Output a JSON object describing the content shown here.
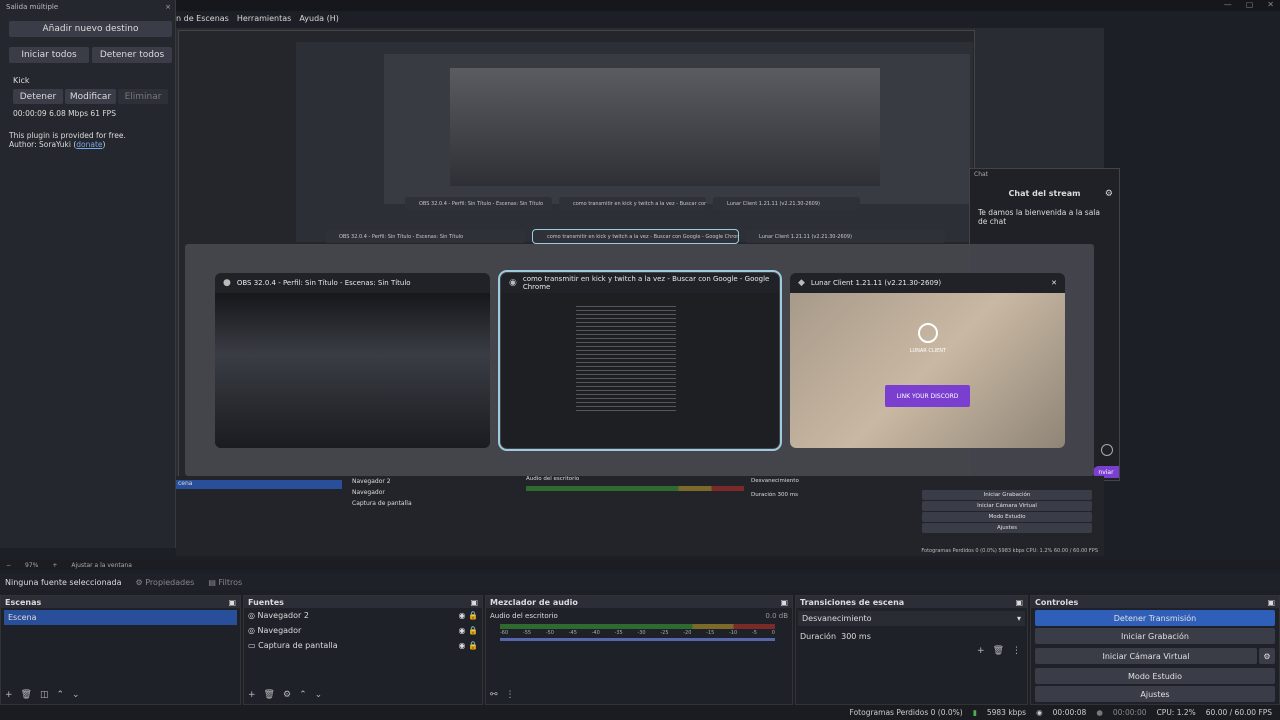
{
  "menu": [
    "n de Escenas",
    "Herramientas",
    "Ayuda (H)"
  ],
  "window_controls": [
    "—",
    "▢",
    "✕"
  ],
  "multi_output": {
    "title": "Salida múltiple",
    "add_destination": "Añadir nuevo destino",
    "start_all": "Iniciar todos",
    "stop_all": "Detener todos",
    "service": "Kick",
    "stop": "Detener",
    "modify": "Modificar",
    "remove": "Eliminar",
    "stats": "00:00:09  6.08 Mbps  61 FPS",
    "free_note": "This plugin is provided for free.",
    "author_prefix": "Author: SoraYuki (",
    "donate": "donate",
    "author_suffix": ")"
  },
  "switcher": {
    "windows": [
      {
        "title": "OBS 32.0.4 - Perfil: Sin Título - Escenas: Sin Título",
        "icon": "obs-icon"
      },
      {
        "title": "como transmitir en kick y twitch a la vez - Buscar con Google - Google Chrome",
        "icon": "chrome-icon"
      },
      {
        "title": "Lunar Client 1.21.11 (v2.21.30-2609)",
        "icon": "lunar-icon"
      }
    ],
    "lunar_logo": "LUNAR CLIENT",
    "lunar_banner": "LINK YOUR DISCORD",
    "close": "✕"
  },
  "chat": {
    "title": "Chat del stream",
    "welcome": "Te damos la bienvenida a la sala de chat",
    "win_label": "Chat"
  },
  "preview_inner": {
    "sources": [
      "Navegador 2",
      "Navegador",
      "Captura de pantalla"
    ],
    "scene": "cena",
    "audio_label": "Audio del escritorio",
    "transition": "Desvanecimiento",
    "duration_label": "Duración",
    "duration": "300 ms",
    "controls": [
      "Iniciar Grabación",
      "Iniciar Cámara Virtual",
      "Modo Estudio",
      "Ajustes"
    ],
    "stop_stream_frag": "nviar",
    "status": "Fotogramas Perdidos 0 (0.0%)   5983 kbps   CPU: 1.2%   60.00 / 60.00 FPS"
  },
  "zoom_bar": {
    "zoom": "97%",
    "fit": "Ajustar a la ventana"
  },
  "source_toolbar": {
    "no_source": "Ninguna fuente seleccionada",
    "properties": "Propiedades",
    "filters": "Filtros"
  },
  "docks": {
    "scenes": {
      "title": "Escenas",
      "items": [
        "Escena"
      ]
    },
    "sources": {
      "title": "Fuentes",
      "items": [
        "Navegador 2",
        "Navegador",
        "Captura de pantalla"
      ]
    },
    "mixer": {
      "title": "Mezclador de audio",
      "channel": "Audio del escritorio",
      "db": "0.0 dB",
      "ticks": [
        "-60",
        "-55",
        "-50",
        "-45",
        "-40",
        "-35",
        "-30",
        "-25",
        "-20",
        "-15",
        "-10",
        "-5",
        "0"
      ]
    },
    "transitions": {
      "title": "Transiciones de escena",
      "type": "Desvanecimiento",
      "duration_label": "Duración",
      "duration": "300 ms"
    },
    "controls": {
      "title": "Controles",
      "stop_stream": "Detener Transmisión",
      "start_record": "Iniciar Grabación",
      "virtual_cam": "Iniciar Cámara Virtual",
      "studio": "Modo Estudio",
      "settings": "Ajustes"
    }
  },
  "statusbar": {
    "dropped": "Fotogramas Perdidos 0 (0.0%)",
    "kbps": "5983 kbps",
    "rec_time": "00:00:08",
    "stream_time": "00:00:00",
    "cpu": "CPU: 1.2%",
    "fps": "60.00 / 60.00 FPS"
  },
  "colors": {
    "accent": "#2f5fb8",
    "selected_scene": "#2a4f9a",
    "highlight": "#9ecbdf"
  }
}
